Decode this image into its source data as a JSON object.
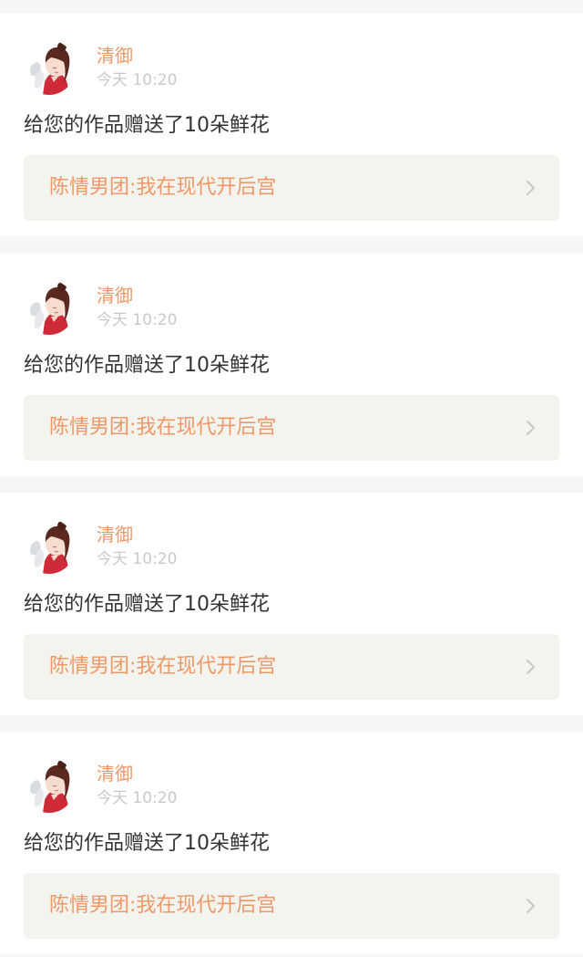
{
  "notifications": [
    {
      "username": "清御",
      "time": "今天 10:20",
      "message": "给您的作品赠送了10朵鲜花",
      "work_title": "陈情男团:我在现代开后宫",
      "avatar_icon": "user-avatar",
      "arrow_icon": "chevron-right-icon"
    },
    {
      "username": "清御",
      "time": "今天 10:20",
      "message": "给您的作品赠送了10朵鲜花",
      "work_title": "陈情男团:我在现代开后宫",
      "avatar_icon": "user-avatar",
      "arrow_icon": "chevron-right-icon"
    },
    {
      "username": "清御",
      "time": "今天 10:20",
      "message": "给您的作品赠送了10朵鲜花",
      "work_title": "陈情男团:我在现代开后宫",
      "avatar_icon": "user-avatar",
      "arrow_icon": "chevron-right-icon"
    },
    {
      "username": "清御",
      "time": "今天 10:20",
      "message": "给您的作品赠送了10朵鲜花",
      "work_title": "陈情男团:我在现代开后宫",
      "avatar_icon": "user-avatar",
      "arrow_icon": "chevron-right-icon"
    }
  ],
  "colors": {
    "accent": "#ef9767",
    "page_background": "#f7f6f6",
    "card_background": "#ffffff",
    "link_background": "#f4f4ee",
    "text": "#333333",
    "muted_text": "#c9c9c9"
  }
}
